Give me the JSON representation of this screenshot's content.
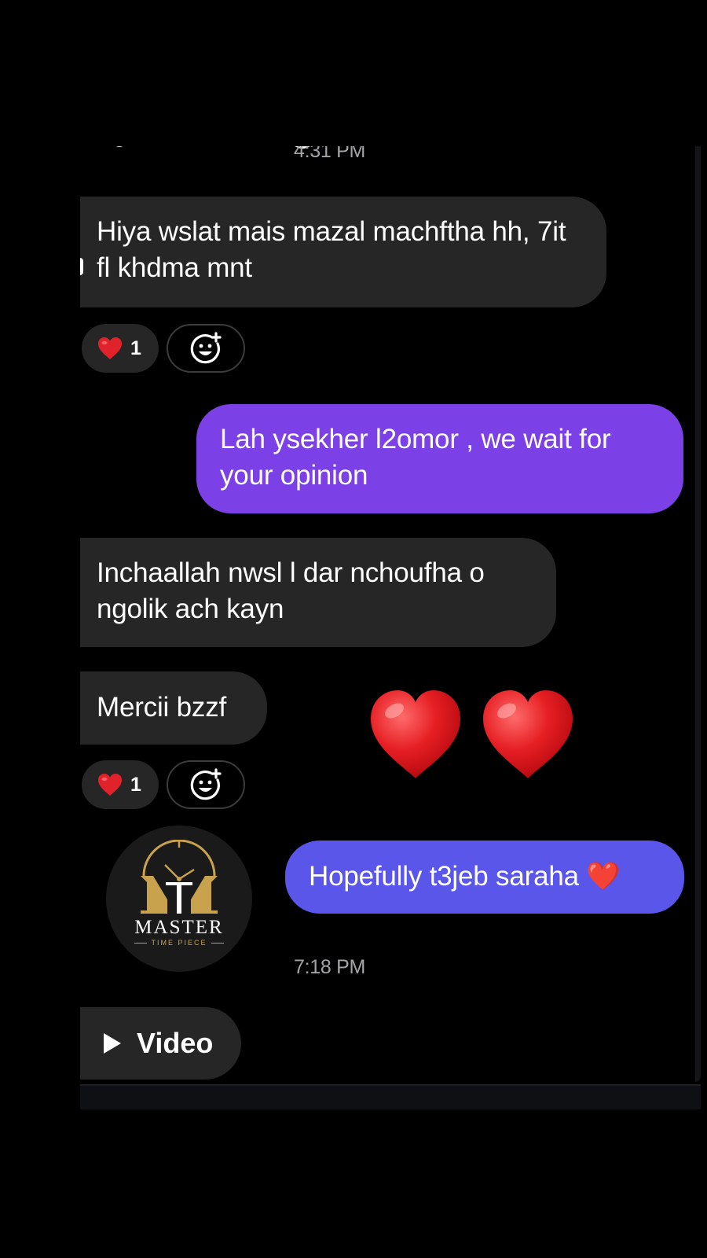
{
  "conversation": {
    "timestamp_top": "4:31 PM",
    "timestamp_bottom": "7:18 PM",
    "messages": [
      {
        "direction": "incoming",
        "text": "Hiya wslat mais mazal machftha hh, 7it fl khdma mnt"
      },
      {
        "direction": "outgoing",
        "text": "Lah ysekher l2omor , we wait for your opinion"
      },
      {
        "direction": "incoming",
        "text": "Inchaallah nwsl l dar nchoufha o ngolik ach kayn"
      },
      {
        "direction": "incoming",
        "text": "Mercii bzzf"
      },
      {
        "direction": "outgoing",
        "text": "Hopefully t3jeb saraha ❤️"
      }
    ],
    "reactions": [
      {
        "emoji": "heart-emoji",
        "count": "1"
      },
      {
        "emoji": "heart-emoji",
        "count": "1"
      }
    ],
    "big_emoji": [
      "❤️",
      "❤️"
    ],
    "video_label": "Video"
  },
  "logo": {
    "brand": "MASTER",
    "subtitle": "TIME PIECE",
    "monogram": "MT"
  },
  "colors": {
    "background": "#000000",
    "incoming_bubble": "#262626",
    "outgoing_bubble": "#7c41e6",
    "outgoing_bubble_gradient_end": "#5956e9",
    "timestamp": "#a4a4a8",
    "gold": "#c8a24c",
    "heart": "#e0222a"
  }
}
